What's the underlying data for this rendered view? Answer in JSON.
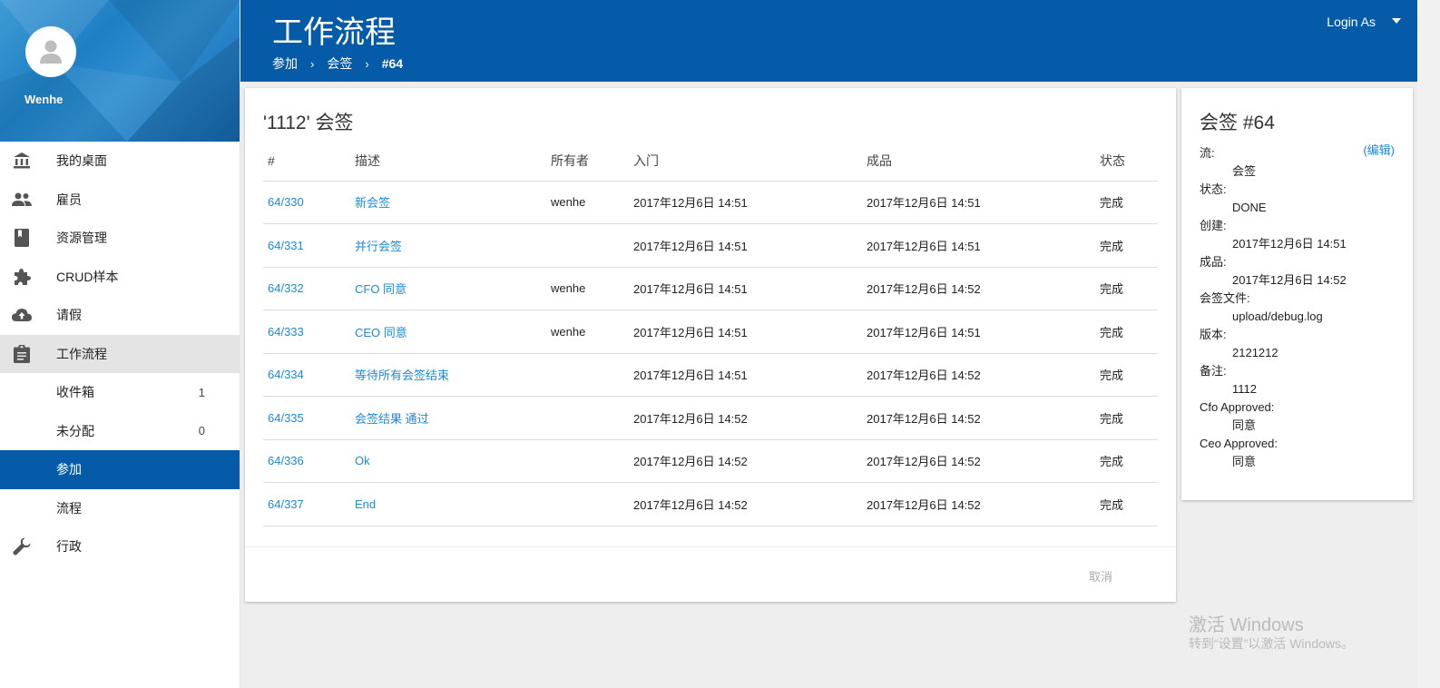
{
  "user": {
    "name": "Wenhe"
  },
  "nav": [
    {
      "label": "我的桌面",
      "icon": "bank-icon"
    },
    {
      "label": "雇员",
      "icon": "people-icon"
    },
    {
      "label": "资源管理",
      "icon": "book-icon"
    },
    {
      "label": "CRUD样本",
      "icon": "puzzle-icon"
    },
    {
      "label": "请假",
      "icon": "cloud-upload-icon"
    },
    {
      "label": "工作流程",
      "icon": "clipboard-icon"
    },
    {
      "label": "收件箱",
      "count": "1"
    },
    {
      "label": "未分配",
      "count": "0"
    },
    {
      "label": "参加"
    },
    {
      "label": "流程"
    },
    {
      "label": "行政",
      "icon": "wrench-icon"
    }
  ],
  "header": {
    "title": "工作流程",
    "breadcrumb": [
      "参加",
      "会签",
      "#64"
    ],
    "login_label": "Login As"
  },
  "main": {
    "title": "'1112' 会签",
    "columns": [
      "#",
      "描述",
      "所有者",
      "入门",
      "成品",
      "状态"
    ],
    "rows": [
      {
        "id": "64/330",
        "desc": "新会签",
        "owner": "wenhe",
        "start": "2017年12月6日 14:51",
        "end": "2017年12月6日 14:51",
        "status": "完成"
      },
      {
        "id": "64/331",
        "desc": "并行会签",
        "owner": "",
        "start": "2017年12月6日 14:51",
        "end": "2017年12月6日 14:51",
        "status": "完成"
      },
      {
        "id": "64/332",
        "desc": "CFO 同意",
        "owner": "wenhe",
        "start": "2017年12月6日 14:51",
        "end": "2017年12月6日 14:52",
        "status": "完成"
      },
      {
        "id": "64/333",
        "desc": "CEO 同意",
        "owner": "wenhe",
        "start": "2017年12月6日 14:51",
        "end": "2017年12月6日 14:51",
        "status": "完成"
      },
      {
        "id": "64/334",
        "desc": "等待所有会签结束",
        "owner": "",
        "start": "2017年12月6日 14:51",
        "end": "2017年12月6日 14:52",
        "status": "完成"
      },
      {
        "id": "64/335",
        "desc": "会签结果 通过",
        "owner": "",
        "start": "2017年12月6日 14:52",
        "end": "2017年12月6日 14:52",
        "status": "完成"
      },
      {
        "id": "64/336",
        "desc": "Ok",
        "owner": "",
        "start": "2017年12月6日 14:52",
        "end": "2017年12月6日 14:52",
        "status": "完成"
      },
      {
        "id": "64/337",
        "desc": "End",
        "owner": "",
        "start": "2017年12月6日 14:52",
        "end": "2017年12月6日 14:52",
        "status": "完成"
      }
    ],
    "cancel_label": "取消"
  },
  "detail": {
    "title": "会签 #64",
    "edit_label": "(编辑)",
    "props": [
      {
        "label": "流:",
        "value": "会签"
      },
      {
        "label": "状态:",
        "value": "DONE"
      },
      {
        "label": "创建:",
        "value": "2017年12月6日 14:51"
      },
      {
        "label": "成品:",
        "value": "2017年12月6日 14:52"
      },
      {
        "label": "会签文件:",
        "value": "upload/debug.log"
      },
      {
        "label": "版本:",
        "value": "2121212"
      },
      {
        "label": "备注:",
        "value": "1112"
      },
      {
        "label": "Cfo Approved:",
        "value": "同意"
      },
      {
        "label": "Ceo Approved:",
        "value": "同意"
      }
    ]
  },
  "watermark": {
    "line1": "激活 Windows",
    "line2": "转到“设置”以激活 Windows。"
  },
  "colors": {
    "primary": "#055ba7",
    "link": "#1c8ad6",
    "active_group": "#e4e4e4"
  }
}
